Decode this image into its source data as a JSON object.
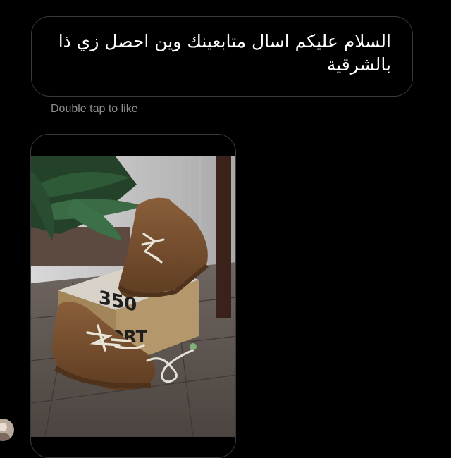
{
  "conversation": {
    "incoming_message": {
      "text": "السلام عليكم اسال متابعينك وين احصل زي ذا بالشرقية"
    },
    "like_hint": "Double tap to like",
    "shared_photo": {
      "box_print_top": "350",
      "box_print_side": "SPORT"
    }
  },
  "colors": {
    "background": "#000000",
    "bubble_border": "#3a3a3a",
    "hint_text": "#8e8e8e",
    "shoe": "#7a5231",
    "box": "#a88a5e",
    "floor": "#5e5550"
  }
}
